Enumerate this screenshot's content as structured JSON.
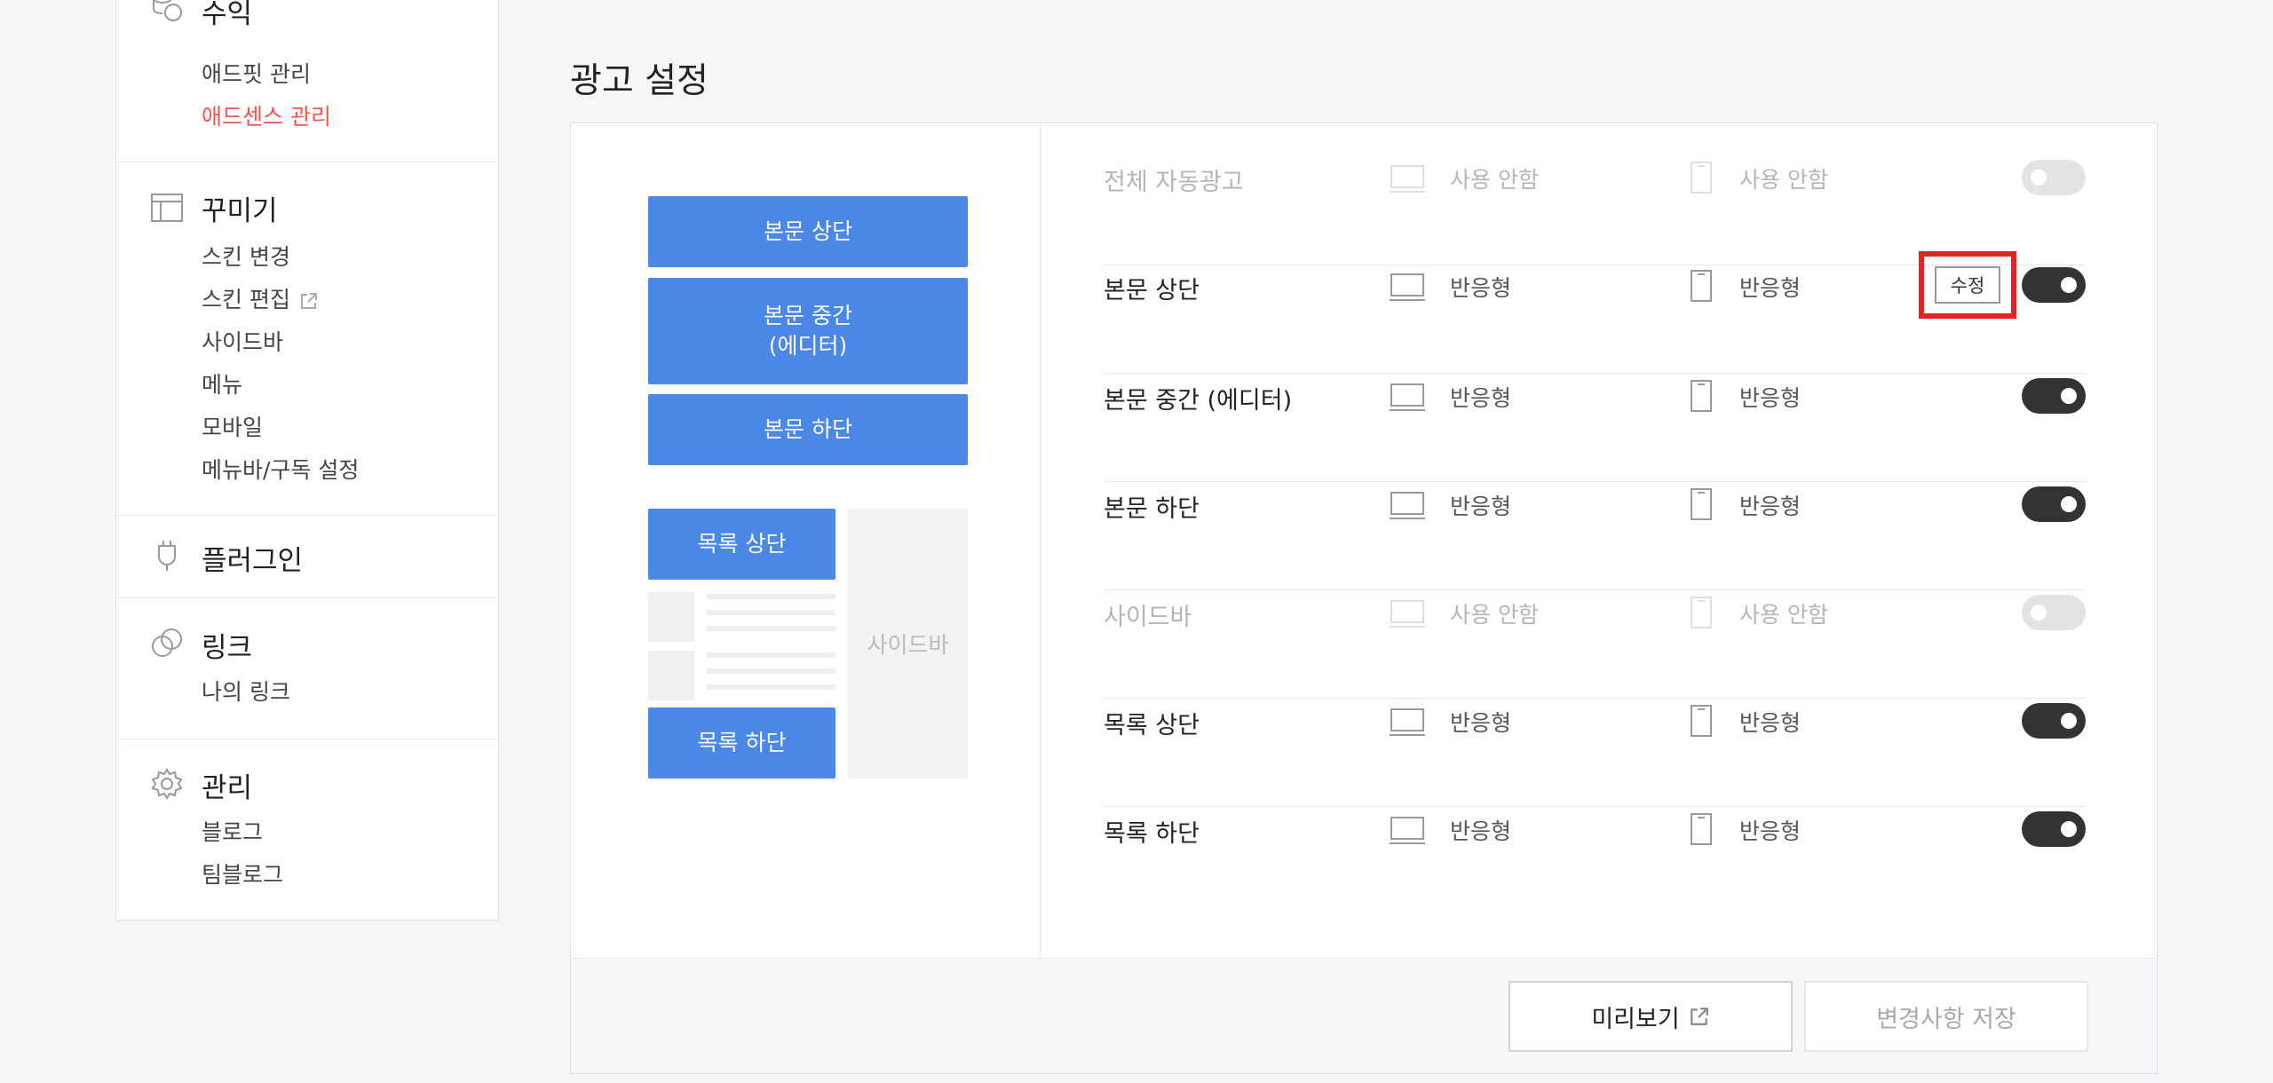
{
  "sidebar": {
    "revenue": {
      "title": "수익",
      "items": [
        "애드핏 관리",
        "애드센스 관리"
      ]
    },
    "decorate": {
      "title": "꾸미기",
      "items": [
        "스킨 변경",
        "스킨 편집",
        "사이드바",
        "메뉴",
        "모바일",
        "메뉴바/구독 설정"
      ]
    },
    "plugin": {
      "title": "플러그인"
    },
    "link": {
      "title": "링크",
      "items": [
        "나의 링크"
      ]
    },
    "manage": {
      "title": "관리",
      "items": [
        "블로그",
        "팀블로그"
      ]
    },
    "active_color": "#f1554c"
  },
  "page_title": "광고 설정",
  "preview": {
    "body_top": "본문 상단",
    "body_middle_1": "본문 중간",
    "body_middle_2": "(에디터)",
    "body_bottom": "본문 하단",
    "list_top": "목록 상단",
    "list_bottom": "목록 하단",
    "sidebar": "사이드바",
    "accent": "#4a87e7"
  },
  "rows": [
    {
      "label": "전체 자동광고",
      "pc": "사용 안함",
      "mobile": "사용 안함",
      "enabled": false
    },
    {
      "label": "본문 상단",
      "pc": "반응형",
      "mobile": "반응형",
      "enabled": true,
      "edit": "수정"
    },
    {
      "label": "본문 중간 (에디터)",
      "pc": "반응형",
      "mobile": "반응형",
      "enabled": true
    },
    {
      "label": "본문 하단",
      "pc": "반응형",
      "mobile": "반응형",
      "enabled": true
    },
    {
      "label": "사이드바",
      "pc": "사용 안함",
      "mobile": "사용 안함",
      "enabled": false
    },
    {
      "label": "목록 상단",
      "pc": "반응형",
      "mobile": "반응형",
      "enabled": true
    },
    {
      "label": "목록 하단",
      "pc": "반응형",
      "mobile": "반응형",
      "enabled": true
    }
  ],
  "footer": {
    "preview": "미리보기",
    "save": "변경사항 저장"
  }
}
